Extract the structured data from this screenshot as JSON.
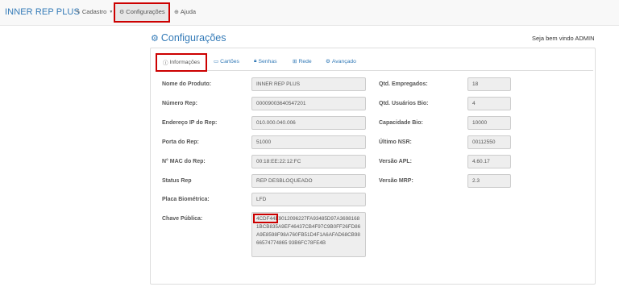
{
  "navbar": {
    "brand": "INNER REP PLUS",
    "items": [
      {
        "label": "Cadastro",
        "icon": "pencil-square-icon",
        "has_caret": true
      },
      {
        "label": "Configurações",
        "icon": "gears-icon",
        "active": true
      },
      {
        "label": "Ajuda",
        "icon": "life-ring-icon"
      }
    ]
  },
  "header": {
    "title": "Configurações",
    "title_icon": "gears-icon",
    "welcome": "Seja bem vindo ADMIN"
  },
  "tabs": [
    {
      "label": "Informações",
      "icon": "info-circle-icon",
      "active": true
    },
    {
      "label": "Cartões",
      "icon": "credit-card-icon"
    },
    {
      "label": "Senhas",
      "icon": "lock-icon"
    },
    {
      "label": "Rede",
      "icon": "sitemap-icon"
    },
    {
      "label": "Avançado",
      "icon": "gear-icon"
    }
  ],
  "left_fields": [
    {
      "label": "Nome do Produto:",
      "value": "INNER REP PLUS"
    },
    {
      "label": "Número Rep:",
      "value": "00009003640547201"
    },
    {
      "label": "Endereço IP do Rep:",
      "value": "010.000.040.006"
    },
    {
      "label": "Porta do Rep:",
      "value": "51000"
    },
    {
      "label": "N° MAC do Rep:",
      "value": "00:18:EE:22:12:FC"
    },
    {
      "label": "Status Rep",
      "value": "REP DESBLOQUEADO"
    },
    {
      "label": "Placa Biométrica:",
      "value": "LFD"
    }
  ],
  "right_fields": [
    {
      "label": "Qtd. Empregados:",
      "value": "18"
    },
    {
      "label": "Qtd. Usuários Bio:",
      "value": "4"
    },
    {
      "label": "Capacidade Bio:",
      "value": "10000"
    },
    {
      "label": "Último NSR:",
      "value": "00112550"
    },
    {
      "label": "Versão APL:",
      "value": "4.60.17"
    },
    {
      "label": "Versão MRP:",
      "value": "2.3"
    }
  ],
  "public_key": {
    "label": "Chave Pública:",
    "value": "4CDF44E9012096227FA93485D97A36981681BCB835A9EF46437CB4F97C9B0FF26FD86A9E8598F98A760FB51D4F1A6AFAD68CB9866574774865 93B6FC78FE4B"
  },
  "colors": {
    "accent": "#337ab7",
    "highlight": "#cc0000"
  }
}
